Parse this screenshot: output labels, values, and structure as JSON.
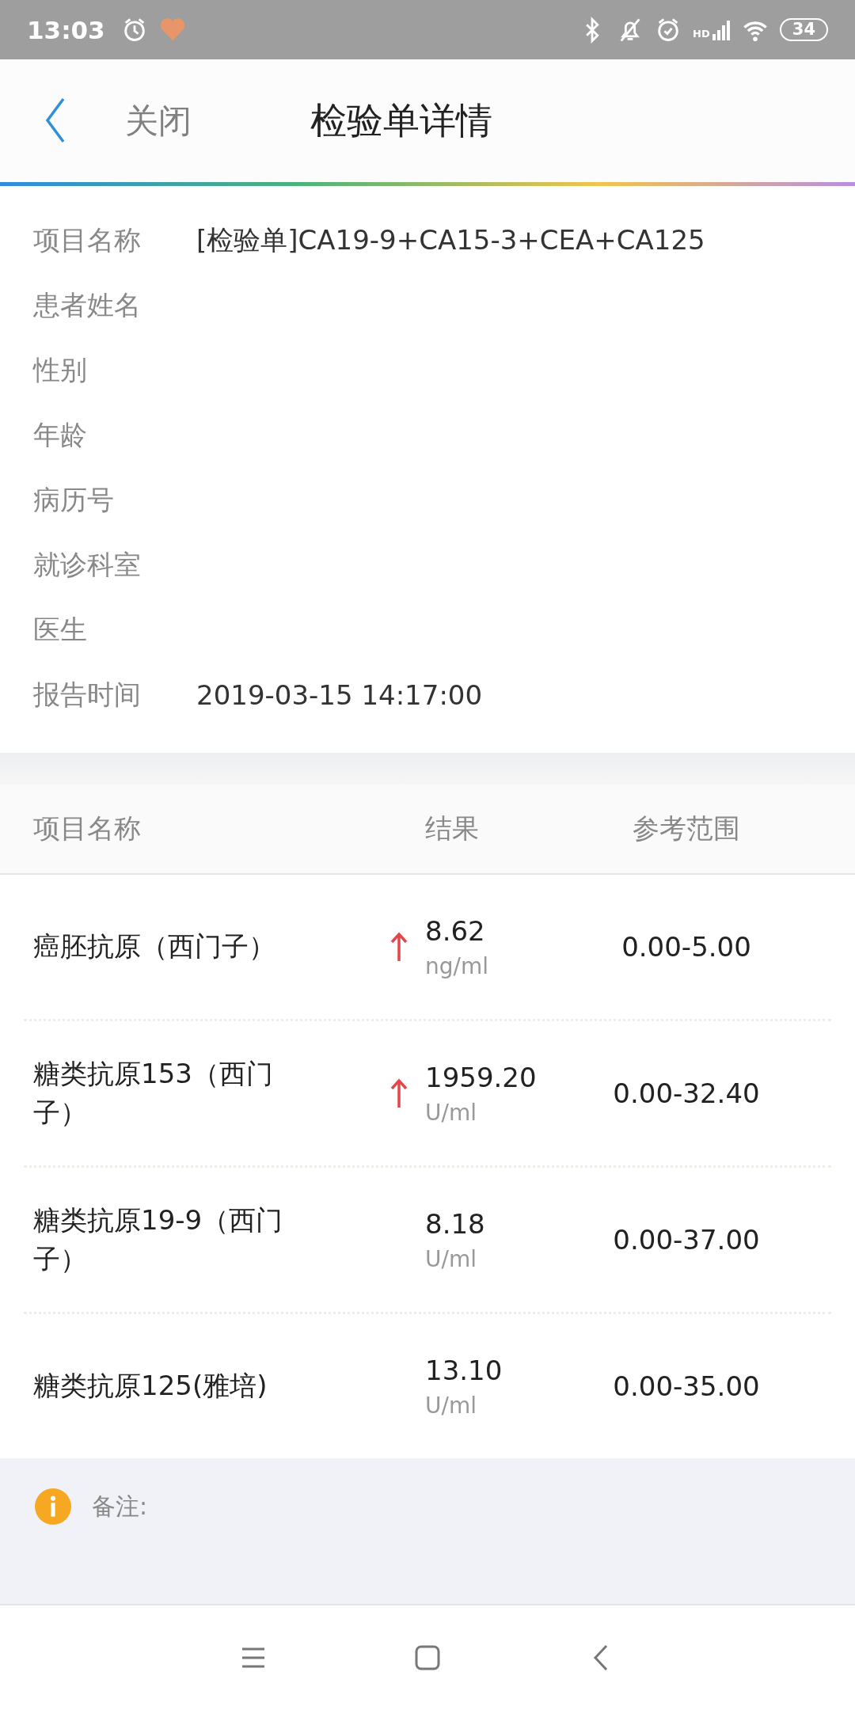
{
  "status_bar": {
    "time": "13:03",
    "network_label": "HD",
    "battery": "34"
  },
  "header": {
    "close": "关闭",
    "title": "检验单详情"
  },
  "info_rows": [
    {
      "label": "项目名称",
      "value": "[检验单]CA19-9+CA15-3+CEA+CA125"
    },
    {
      "label": "患者姓名"
    },
    {
      "label": "性别"
    },
    {
      "label": "年龄"
    },
    {
      "label": "病历号"
    },
    {
      "label": "就诊科室"
    },
    {
      "label": "医生"
    },
    {
      "label": "报告时间",
      "value": "2019-03-15 14:17:00"
    }
  ],
  "table": {
    "columns": [
      "项目名称",
      "结果",
      "参考范围"
    ],
    "rows": [
      {
        "name": "癌胚抗原（西门子）",
        "high": true,
        "value": "8.62",
        "unit": "ng/ml",
        "range": "0.00-5.00"
      },
      {
        "name": "糖类抗原153（西门子）",
        "high": true,
        "value": "1959.20",
        "unit": "U/ml",
        "range": "0.00-32.40"
      },
      {
        "name": "糖类抗原19-9（西门子）",
        "high": false,
        "value": "8.18",
        "unit": "U/ml",
        "range": "0.00-37.00"
      },
      {
        "name": "糖类抗原125(雅培)",
        "high": false,
        "value": "13.10",
        "unit": "U/ml",
        "range": "0.00-35.00"
      }
    ]
  },
  "remarks": {
    "label": "备注:"
  }
}
